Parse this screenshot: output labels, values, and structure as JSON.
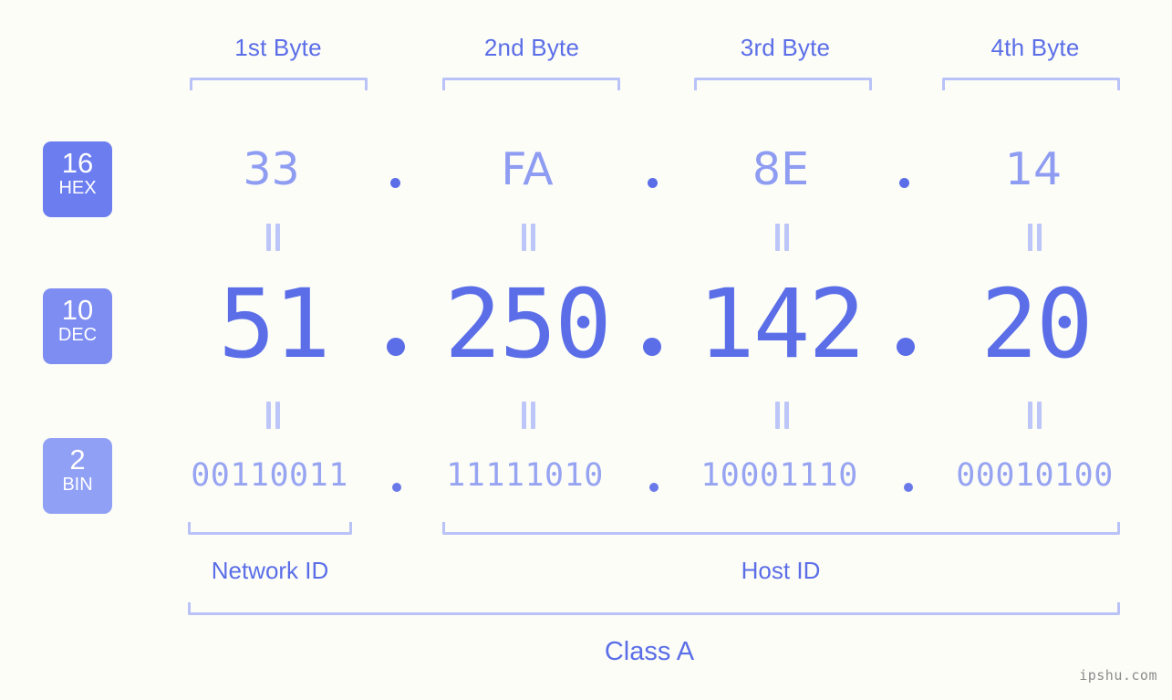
{
  "page": {
    "background_color": "#fcfdf7",
    "accent_color": "#5b6ee8",
    "accent_light_color": "#8e9cf2",
    "bracket_color": "#b9c3f7",
    "watermark": "ipshu.com"
  },
  "byte_headers": [
    {
      "label": "1st Byte"
    },
    {
      "label": "2nd Byte"
    },
    {
      "label": "3rd Byte"
    },
    {
      "label": "4th Byte"
    }
  ],
  "bases": [
    {
      "number": "16",
      "abbr": "HEX",
      "color": "#6c7df0"
    },
    {
      "number": "10",
      "abbr": "DEC",
      "color": "#7e8df2"
    },
    {
      "number": "2",
      "abbr": "BIN",
      "color": "#90a0f5"
    }
  ],
  "rows": {
    "hex": {
      "base": "16",
      "name": "HEX",
      "octets": [
        "33",
        "FA",
        "8E",
        "14"
      ],
      "separator": "."
    },
    "dec": {
      "base": "10",
      "name": "DEC",
      "octets": [
        "51",
        "250",
        "142",
        "20"
      ],
      "separator": "."
    },
    "bin": {
      "base": "2",
      "name": "BIN",
      "octets": [
        "00110011",
        "11111010",
        "10001110",
        "00010100"
      ],
      "separator": "."
    }
  },
  "equality": {
    "symbol": "="
  },
  "segments": {
    "network_id": {
      "label": "Network ID"
    },
    "host_id": {
      "label": "Host ID"
    },
    "class": {
      "label": "Class A"
    }
  },
  "ip_address": {
    "dotted_decimal": "51.250.142.20",
    "hex": "33.FA.8E.14",
    "binary": "00110011.11111010.10001110.00010100",
    "class": "Class A"
  }
}
